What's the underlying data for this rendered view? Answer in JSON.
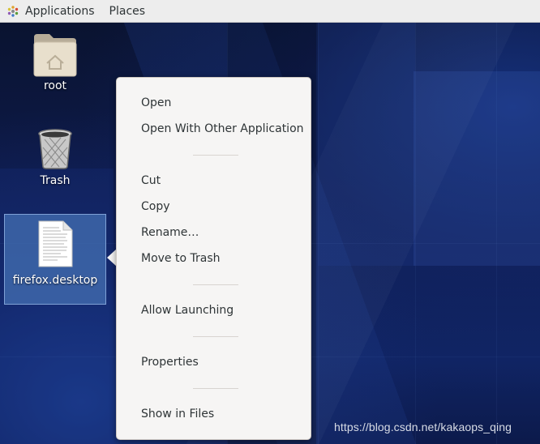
{
  "topbar": {
    "applications_label": "Applications",
    "places_label": "Places"
  },
  "desktop": {
    "icons": [
      {
        "label": "root",
        "icon": "home-folder-icon"
      },
      {
        "label": "Trash",
        "icon": "trash-icon"
      },
      {
        "label": "firefox.desktop",
        "icon": "text-file-icon",
        "selected": true
      }
    ]
  },
  "context_menu": {
    "items": [
      "Open",
      "Open With Other Application",
      "Cut",
      "Copy",
      "Rename…",
      "Move to Trash",
      "Allow Launching",
      "Properties",
      "Show in Files"
    ]
  },
  "watermark": "https://blog.csdn.net/kakaops_qing",
  "colors": {
    "topbar_bg": "#ededed",
    "menu_bg": "#f6f5f4",
    "selection_bg": "#3e67aa"
  }
}
